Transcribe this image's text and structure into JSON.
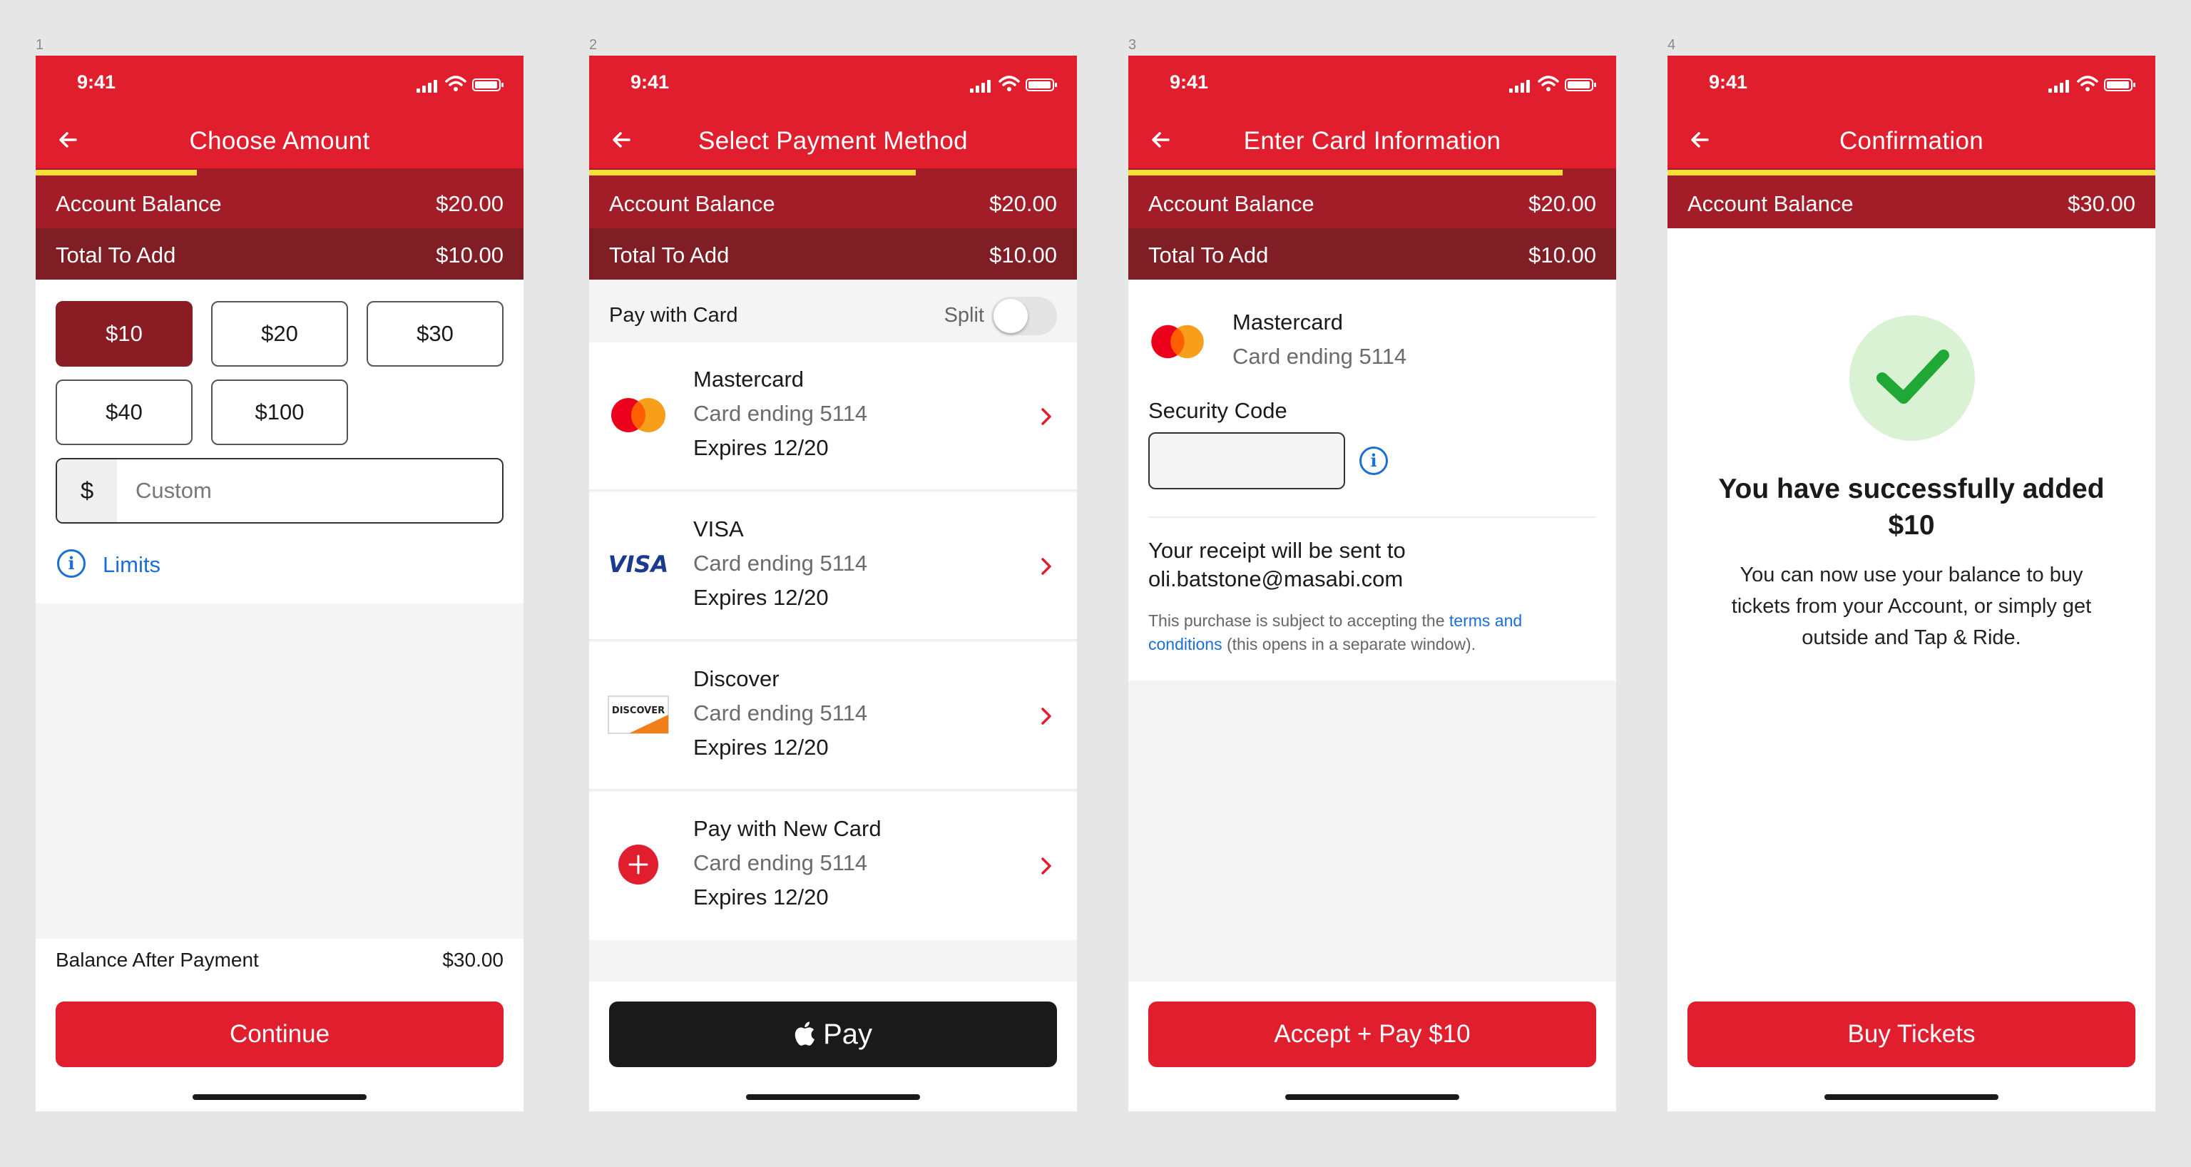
{
  "status_bar": {
    "time": "9:41"
  },
  "labels": {
    "account_balance": "Account Balance",
    "total_to_add": "Total To Add",
    "card_ending": "Card ending 5114",
    "expires": "Expires 12/20"
  },
  "colors": {
    "brand_red": "#e01e2e",
    "dark_red": "#a31d28",
    "darker_red": "#801e25",
    "progress_yellow": "#f5e03b",
    "link_blue": "#1a6fd6"
  },
  "screens": [
    {
      "number": "1",
      "title": "Choose Amount",
      "progress": 0.33,
      "account_balance": "$20.00",
      "total_to_add": "$10.00",
      "amount_options": [
        "$10",
        "$20",
        "$30",
        "$40",
        "$100"
      ],
      "selected_amount": "$10",
      "custom": {
        "currency": "$",
        "placeholder": "Custom"
      },
      "limits_label": "Limits",
      "balance_after": {
        "label": "Balance After Payment",
        "value": "$30.00"
      },
      "cta": "Continue"
    },
    {
      "number": "2",
      "title": "Select Payment Method",
      "progress": 0.67,
      "account_balance": "$20.00",
      "total_to_add": "$10.00",
      "pay_with_card": "Pay with Card",
      "split_label": "Split",
      "split_on": false,
      "cards": [
        {
          "name": "Mastercard",
          "icon": "mastercard-logo"
        },
        {
          "name": "VISA",
          "icon": "visa-logo"
        },
        {
          "name": "Discover",
          "icon": "discover-logo"
        },
        {
          "name": "Pay with New Card",
          "icon": "plus-circle-icon"
        }
      ],
      "visa_logo_text": "VISA",
      "discover_logo_text": "DISCOVER",
      "cta": "Pay",
      "cta_icon": "apple-logo-icon"
    },
    {
      "number": "3",
      "title": "Enter Card Information",
      "progress": 0.89,
      "account_balance": "$20.00",
      "total_to_add": "$10.00",
      "card_name": "Mastercard",
      "security_code_label": "Security Code",
      "security_code_value": "",
      "receipt_line1": "Your receipt will be sent to",
      "receipt_email": "oli.batstone@masabi.com",
      "terms_prefix": "This purchase is subject to accepting the ",
      "terms_link": "terms and conditions",
      "terms_suffix": " (this opens in a separate window).",
      "cta": "Accept + Pay $10"
    },
    {
      "number": "4",
      "title": "Confirmation",
      "progress": 1.0,
      "account_balance": "$30.00",
      "success_title": "You have successfully added $10",
      "success_text": "You can now use your balance to buy tickets from your Account, or simply get outside and Tap & Ride.",
      "cta": "Buy Tickets"
    }
  ]
}
